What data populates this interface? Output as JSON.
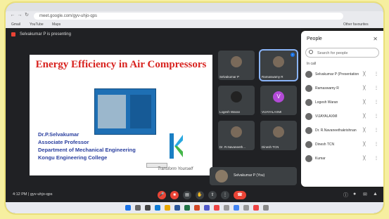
{
  "browser": {
    "url": "meet.google.com/gyv-uhjo-qps",
    "bookmarks": [
      "Gmail",
      "YouTube",
      "Maps",
      "Other favourites"
    ]
  },
  "meeting": {
    "presenting_label": "Selvakumar P is presenting",
    "slide": {
      "title": "Energy Efficiency in Air Compressors",
      "presenter_name": "Dr.P.Selvakumar",
      "designation": "Associate Professor",
      "department": "Department of Mechanical Engineering",
      "college": "Kongu Engineering College",
      "tagline": "Transform Yourself"
    },
    "tiles": [
      {
        "name": "Selvakumar P",
        "active": false
      },
      {
        "name": "Ramaswamy R",
        "active": true
      },
      {
        "name": "Logesh Waran",
        "active": false
      },
      {
        "name": "VIJAYALAXMI",
        "active": false
      },
      {
        "name": "Dr. R.Navaneeth...",
        "active": false
      },
      {
        "name": "Dinesh TCN",
        "active": false
      }
    ],
    "self_view_name": "Selvakumar P (You)",
    "time": "4:12 PM",
    "meeting_code": "gyv-uhjo-qps"
  },
  "people_panel": {
    "title": "People",
    "search_placeholder": "Search for people",
    "section_label": "In call",
    "participants": [
      "Selvakumar P (Presentation)",
      "Ramaswamy R",
      "Logesh Waran",
      "VIJAYALAXMI",
      "Dr. R.Navaneethakrishnan",
      "Dinesh TCN",
      "Kumar"
    ]
  },
  "colors": {
    "accent": "#1a73e8",
    "end_call": "#ea4335",
    "slide_title": "#d8231f",
    "slide_text": "#2a3f9f"
  }
}
